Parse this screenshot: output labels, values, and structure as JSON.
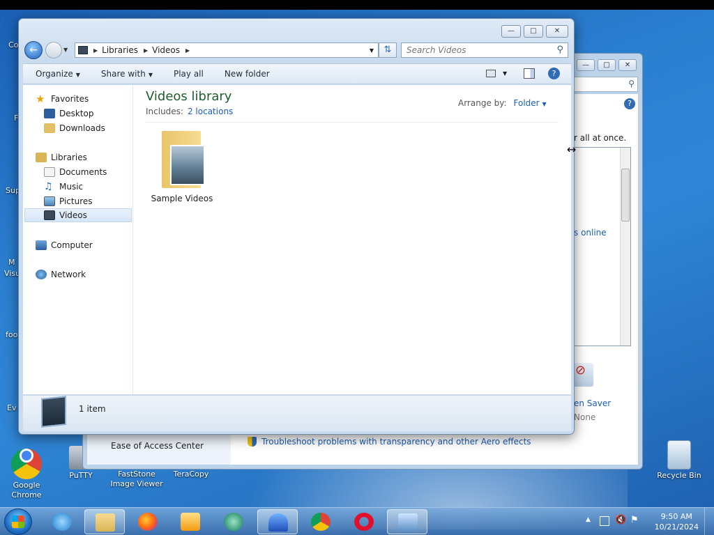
{
  "colors": {
    "accent_link": "#1b5fb3",
    "library_title": "#1e5d2e",
    "window_frame": "#c9dbee",
    "desktop": "#2b7fd0"
  },
  "explorer": {
    "breadcrumb": [
      "Libraries",
      "Videos"
    ],
    "search_placeholder": "Search Videos",
    "toolbar": {
      "organize": "Organize",
      "share_with": "Share with",
      "play_all": "Play all",
      "new_folder": "New folder"
    },
    "nav": {
      "favorites": "Favorites",
      "desktop": "Desktop",
      "downloads": "Downloads",
      "libraries": "Libraries",
      "documents": "Documents",
      "music": "Music",
      "pictures": "Pictures",
      "videos": "Videos",
      "computer": "Computer",
      "network": "Network"
    },
    "library_title": "Videos library",
    "includes_label": "Includes:",
    "includes_link": "2 locations",
    "arrange_label": "Arrange by:",
    "arrange_value": "Folder",
    "folder_name": "Sample Videos",
    "status_count": "1 item"
  },
  "background_window": {
    "text_all_at_once": "r all at once.",
    "link_online": "s online",
    "screen_saver": "en Saver",
    "none": "None",
    "ease_of_access": "Ease of Access Center",
    "troubleshoot": "Troubleshoot problems with transparency and other Aero effects"
  },
  "desktop_icons": {
    "google_chrome": "Google Chrome",
    "putty": "PuTTY",
    "faststone": "FastStone Image Viewer",
    "teracopy": "TeraCopy",
    "recycle_bin": "Recycle Bin",
    "edge_fragments": [
      "Co",
      "F",
      "Sup",
      "M",
      "Visu",
      "foo",
      "Ev"
    ]
  },
  "taskbar": {
    "time": "9:50 AM",
    "date": "10/21/2024"
  }
}
